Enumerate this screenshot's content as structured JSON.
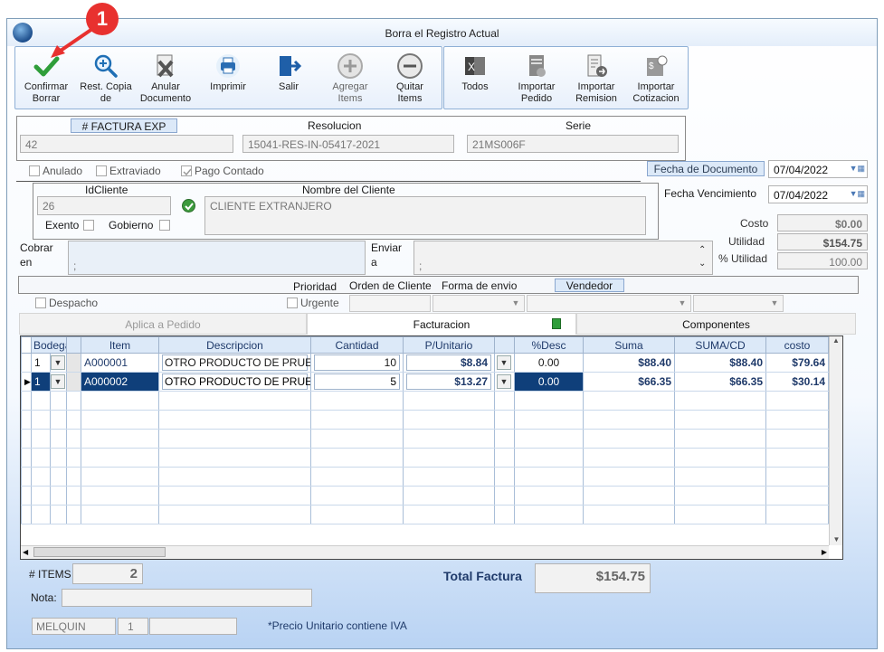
{
  "annotation": {
    "badge": "1"
  },
  "window": {
    "title": "Borra el Registro Actual"
  },
  "toolbar": {
    "left": [
      {
        "label1": "Confirmar",
        "label2": "Borrar"
      },
      {
        "label1": "Rest. Copia",
        "label2": "de"
      },
      {
        "label1": "Anular",
        "label2": "Documento"
      },
      {
        "label1": "Imprimir",
        "label2": ""
      },
      {
        "label1": "Salir",
        "label2": ""
      },
      {
        "label1": "Agregar",
        "label2": "Items"
      },
      {
        "label1": "Quitar",
        "label2": "Items"
      }
    ],
    "right": [
      {
        "label1": "Todos",
        "label2": ""
      },
      {
        "label1": "Importar",
        "label2": "Pedido"
      },
      {
        "label1": "Importar",
        "label2": "Remision"
      },
      {
        "label1": "Importar",
        "label2": "Cotizacion"
      }
    ]
  },
  "invoice": {
    "factura_label": "# FACTURA EXP",
    "factura_value": "42",
    "resolucion_label": "Resolucion",
    "resolucion_value": "15041-RES-IN-05417-2021",
    "serie_label": "Serie",
    "serie_value": "21MS006F"
  },
  "flags": {
    "anulado": "Anulado",
    "extraviado": "Extraviado",
    "pago_contado": "Pago Contado"
  },
  "dates": {
    "fecha_documento_label": "Fecha de  Documento",
    "fecha_documento": "07/04/2022",
    "fecha_vencimiento_label": "Fecha Vencimiento",
    "fecha_vencimiento": "07/04/2022"
  },
  "client": {
    "id_label": "IdCliente",
    "id_value": "26",
    "nombre_label": "Nombre del Cliente",
    "nombre_value": "CLIENTE EXTRANJERO",
    "exento": "Exento",
    "gobierno": "Gobierno"
  },
  "totals_side": {
    "costo_label": "Costo",
    "costo": "$0.00",
    "utilidad_label": "Utilidad",
    "utilidad": "$154.75",
    "pct_label": "% Utilidad",
    "pct": "100.00"
  },
  "addresses": {
    "cobrar_label1": "Cobrar",
    "cobrar_label2": "en",
    "cobrar_value": ";",
    "enviar_label1": "Enviar",
    "enviar_label2": "a",
    "enviar_value": ";"
  },
  "options": {
    "prioridad": "Prioridad",
    "orden": "Orden de Cliente",
    "forma": "Forma de envio",
    "vendedor": "Vendedor",
    "despacho": "Despacho",
    "urgente": "Urgente"
  },
  "tabs": [
    "Aplica a Pedido",
    "Facturacion",
    "Componentes"
  ],
  "grid": {
    "columns": [
      "Bodega",
      "",
      "",
      "Item",
      "Descripcion",
      "Cantidad",
      "P/Unitario",
      "",
      "%Desc",
      "Suma",
      "SUMA/CD",
      "costo"
    ],
    "rows": [
      {
        "bodega": "1",
        "item": "A000001",
        "desc": "OTRO PRODUCTO DE PRUE",
        "cantidad": "10",
        "punit": "$8.84",
        "desc_pct": "0.00",
        "suma": "$88.40",
        "sumacd": "$88.40",
        "costo": "$79.64"
      },
      {
        "bodega": "1",
        "item": "A000002",
        "desc": "OTRO PRODUCTO DE PRUE",
        "cantidad": "5",
        "punit": "$13.27",
        "desc_pct": "0.00",
        "suma": "$66.35",
        "sumacd": "$66.35",
        "costo": "$30.14"
      }
    ]
  },
  "footer": {
    "items_label": "# ITEMS",
    "items_value": "2",
    "total_label": "Total Factura",
    "total_value": "$154.75",
    "nota_label": "Nota:",
    "user": "MELQUIN",
    "user_num": "1",
    "iva_note": "*Precio Unitario contiene IVA"
  },
  "colors": {
    "accent": "#0f3f7a",
    "header_bg": "#dce9f8",
    "annotation": "#e8312f"
  }
}
